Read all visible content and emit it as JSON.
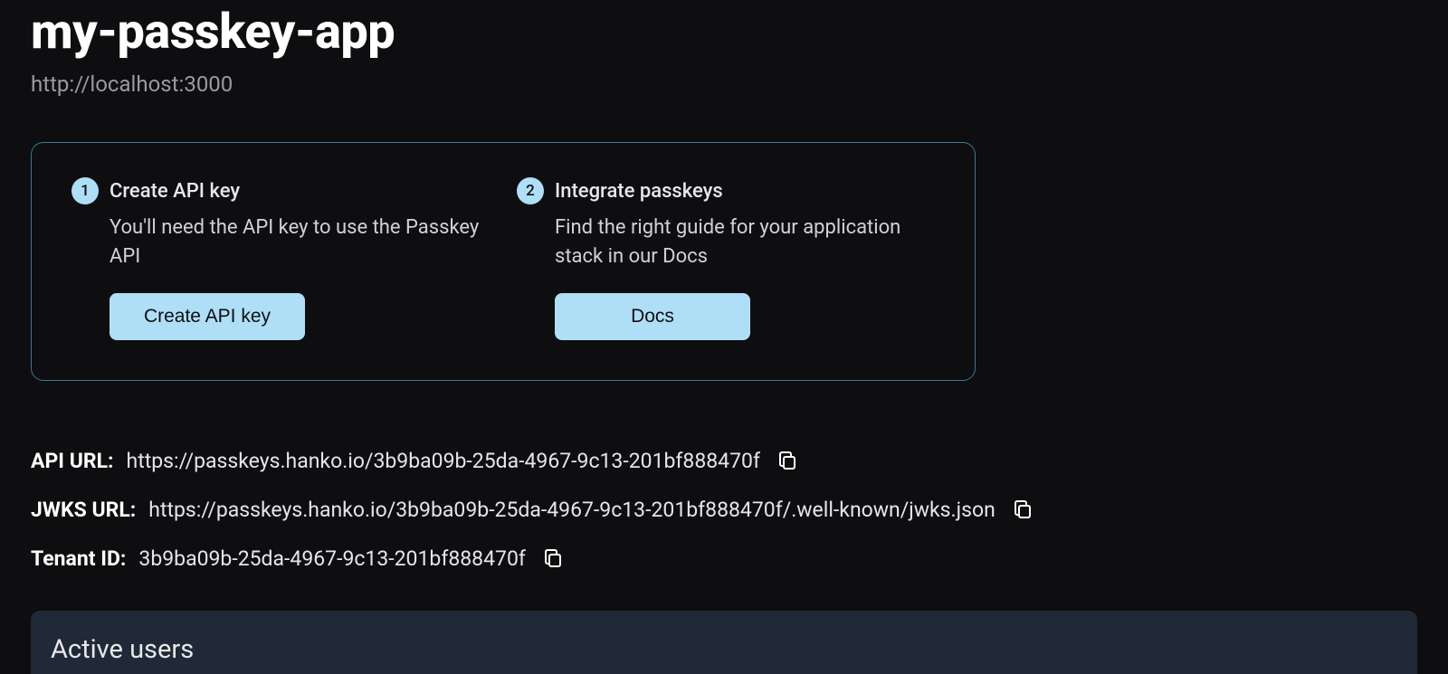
{
  "header": {
    "title": "my-passkey-app",
    "subtitle": "http://localhost:3000"
  },
  "steps": [
    {
      "badge": "1",
      "title": "Create API key",
      "desc": "You'll need the API key to use the Passkey API",
      "button": "Create API key"
    },
    {
      "badge": "2",
      "title": "Integrate passkeys",
      "desc": "Find the right guide for your application stack in our Docs",
      "button": "Docs"
    }
  ],
  "info": {
    "api_url_label": "API URL:",
    "api_url_value": "https://passkeys.hanko.io/3b9ba09b-25da-4967-9c13-201bf888470f",
    "jwks_url_label": "JWKS URL:",
    "jwks_url_value": "https://passkeys.hanko.io/3b9ba09b-25da-4967-9c13-201bf888470f/.well-known/jwks.json",
    "tenant_id_label": "Tenant ID:",
    "tenant_id_value": "3b9ba09b-25da-4967-9c13-201bf888470f"
  },
  "active_users": {
    "title": "Active users"
  }
}
